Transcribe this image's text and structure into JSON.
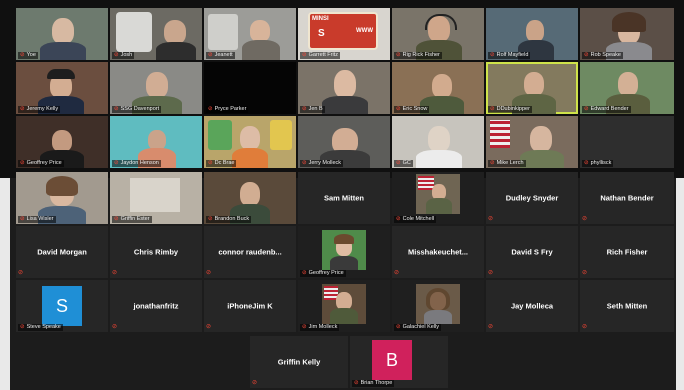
{
  "tiles": {
    "yoe": "Yoe",
    "josh": "Josh",
    "jeanett": "Jeanett",
    "garrett": "Garrett Fritz",
    "rick_kunz": "Rig Rick Fisher",
    "rolf": "Rolf Mayfield",
    "rob_speake": "Rob Speake",
    "jeremy": "Jeremy Kelly",
    "sso_davenport": "SSG Davenport",
    "pryce": "Pryce Parker",
    "jen": "Jen B",
    "eric_snow": "Eric Snow",
    "dustin": "DDubinkipper",
    "edward": "Edward Bender",
    "geoffrey_price_top": "Geoffrey Price",
    "jaydon": "Jaydon Henson",
    "dc_brae": "Dc Brae",
    "jeremy_moleck": "Jerry Molleck",
    "gc": "GC",
    "mike_lerch": "Mike Lerch",
    "phyllisk": "phyllisck",
    "lisa_wisler": "Lisa Wisler",
    "griffin_ester": "Griffin Ester",
    "brandon_buck": "Brandon Buck",
    "sam_mitten": "Sam Mitten",
    "cole_mitchell": "Cole Mitchell",
    "dudley_snyder": "Dudley Snyder",
    "nathan_bender": "Nathan Bender",
    "david_morgan": "David Morgan",
    "chris_rimby": "Chris Rimby",
    "connor": "connor  raudenb...",
    "geoffrey_price": "Geoffrey Price",
    "misshakeuchet": "Misshakeuchet...",
    "david_s_fry": "David S Fry",
    "rich_fisher": "Rich Fisher",
    "steve_speake": "Steve Speake",
    "jonathanfritz": "jonathanfritz",
    "iphonejim": "iPhoneJim K",
    "jim_molleck": "Jim Molleck",
    "galachiel_kelly": "Galachiel Kelly",
    "jay_molleca": "Jay Molleca",
    "seth_mitten": "Seth Mitten",
    "griffin_kelly": "Griffin Kelly",
    "brian_thorpe": "Brian Thorpe"
  },
  "avatars": {
    "steve_initial": "S",
    "brian_initial": "B"
  },
  "patch": {
    "minsi_left": "MINSI",
    "minsi_s": "S",
    "minsi_www": "WWW"
  },
  "colors": {
    "steve_avatar": "#1f8fd6",
    "brian_avatar": "#d0215c",
    "active_outline": "#cfe34a",
    "muted_icon": "#ff4a3a"
  }
}
